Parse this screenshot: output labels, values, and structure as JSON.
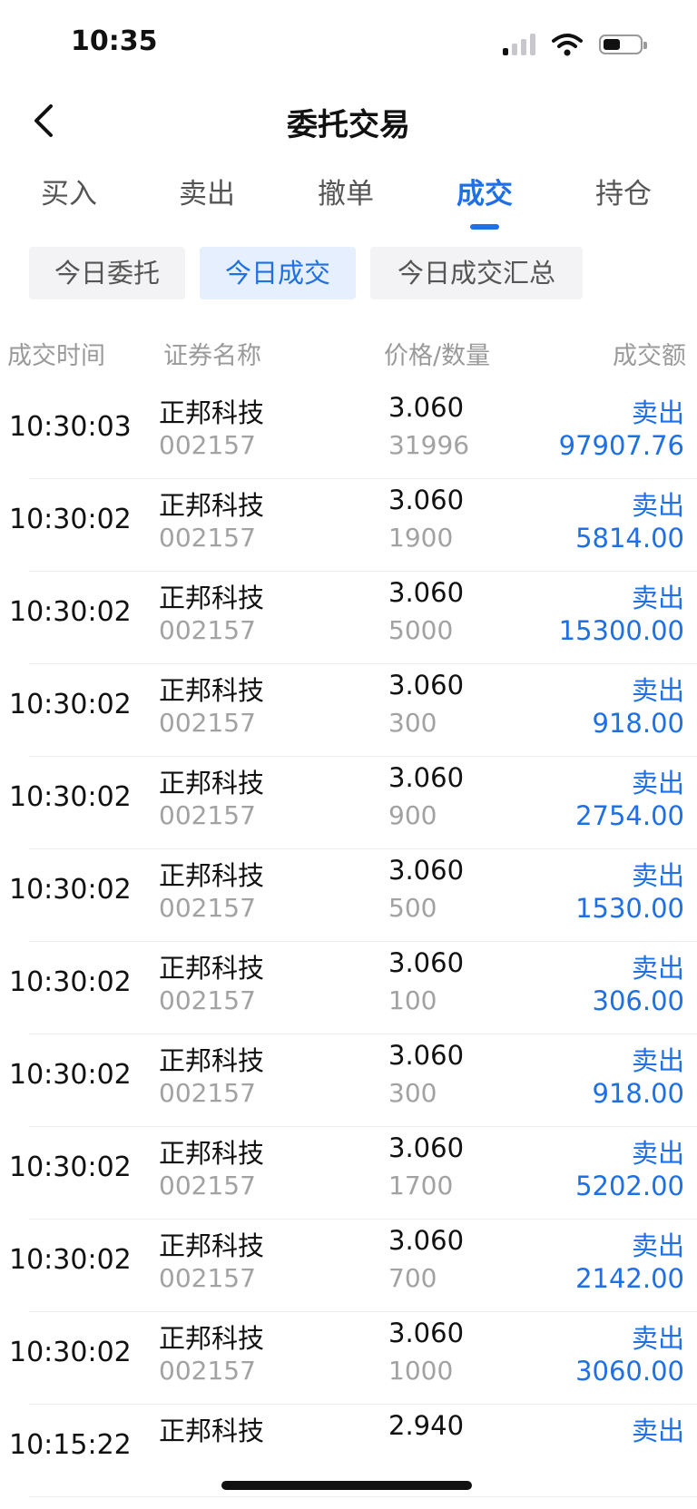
{
  "status": {
    "time": "10:35"
  },
  "header": {
    "title": "委托交易"
  },
  "tabs": [
    {
      "label": "买入"
    },
    {
      "label": "卖出"
    },
    {
      "label": "撤单"
    },
    {
      "label": "成交"
    },
    {
      "label": "持仓"
    }
  ],
  "active_tab": "成交",
  "subtabs": [
    {
      "label": "今日委托"
    },
    {
      "label": "今日成交"
    },
    {
      "label": "今日成交汇总"
    }
  ],
  "active_subtab": "今日成交",
  "table": {
    "columns": [
      "成交时间",
      "证券名称",
      "价格/数量",
      "成交额"
    ],
    "rows": [
      {
        "time": "10:30:03",
        "name": "正邦科技",
        "code": "002157",
        "price": "3.060",
        "qty": "31996",
        "direction": "卖出",
        "amount": "97907.76"
      },
      {
        "time": "10:30:02",
        "name": "正邦科技",
        "code": "002157",
        "price": "3.060",
        "qty": "1900",
        "direction": "卖出",
        "amount": "5814.00"
      },
      {
        "time": "10:30:02",
        "name": "正邦科技",
        "code": "002157",
        "price": "3.060",
        "qty": "5000",
        "direction": "卖出",
        "amount": "15300.00"
      },
      {
        "time": "10:30:02",
        "name": "正邦科技",
        "code": "002157",
        "price": "3.060",
        "qty": "300",
        "direction": "卖出",
        "amount": "918.00"
      },
      {
        "time": "10:30:02",
        "name": "正邦科技",
        "code": "002157",
        "price": "3.060",
        "qty": "900",
        "direction": "卖出",
        "amount": "2754.00"
      },
      {
        "time": "10:30:02",
        "name": "正邦科技",
        "code": "002157",
        "price": "3.060",
        "qty": "500",
        "direction": "卖出",
        "amount": "1530.00"
      },
      {
        "time": "10:30:02",
        "name": "正邦科技",
        "code": "002157",
        "price": "3.060",
        "qty": "100",
        "direction": "卖出",
        "amount": "306.00"
      },
      {
        "time": "10:30:02",
        "name": "正邦科技",
        "code": "002157",
        "price": "3.060",
        "qty": "300",
        "direction": "卖出",
        "amount": "918.00"
      },
      {
        "time": "10:30:02",
        "name": "正邦科技",
        "code": "002157",
        "price": "3.060",
        "qty": "1700",
        "direction": "卖出",
        "amount": "5202.00"
      },
      {
        "time": "10:30:02",
        "name": "正邦科技",
        "code": "002157",
        "price": "3.060",
        "qty": "700",
        "direction": "卖出",
        "amount": "2142.00"
      },
      {
        "time": "10:30:02",
        "name": "正邦科技",
        "code": "002157",
        "price": "3.060",
        "qty": "1000",
        "direction": "卖出",
        "amount": "3060.00"
      },
      {
        "time": "10:15:22",
        "name": "正邦科技",
        "code": "",
        "price": "2.940",
        "qty": "",
        "direction": "卖出",
        "amount": ""
      }
    ]
  },
  "colors": {
    "accent": "#1f6fe5",
    "muted": "#a2a2a2"
  }
}
